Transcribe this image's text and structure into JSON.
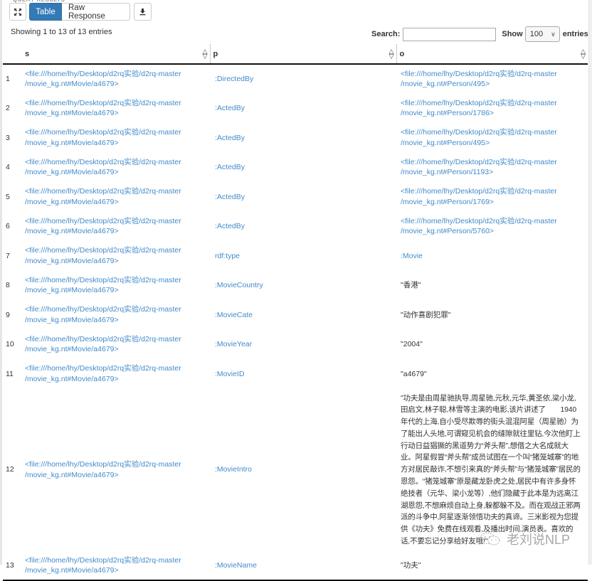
{
  "section_title": "Query Results",
  "toolbar": {
    "expand_icon": "expand-icon",
    "table_label": "Table",
    "raw_label": "Raw Response",
    "download_icon": "download-icon"
  },
  "info": "Showing 1 to 13 of 13 entries",
  "search": {
    "label": "Search:",
    "value": "",
    "placeholder": ""
  },
  "length": {
    "show_label": "Show",
    "selected": "100",
    "entries_label": "entries"
  },
  "colors": {
    "accent": "#337ab7",
    "link": "#428bca"
  },
  "columns": [
    {
      "label": "s"
    },
    {
      "label": "p"
    },
    {
      "label": "o"
    }
  ],
  "rows": [
    {
      "idx": "1",
      "s": "<file:///home/lhy/Desktop/d2rq实验/d2rq-master /movie_kg.nt#Movie/a4679>",
      "p": ":DirectedBy",
      "o": "<file:///home/lhy/Desktop/d2rq实验/d2rq-master /movie_kg.nt#Person/495>",
      "o_type": "uri"
    },
    {
      "idx": "2",
      "s": "<file:///home/lhy/Desktop/d2rq实验/d2rq-master /movie_kg.nt#Movie/a4679>",
      "p": ":ActedBy",
      "o": "<file:///home/lhy/Desktop/d2rq实验/d2rq-master /movie_kg.nt#Person/1786>",
      "o_type": "uri"
    },
    {
      "idx": "3",
      "s": "<file:///home/lhy/Desktop/d2rq实验/d2rq-master /movie_kg.nt#Movie/a4679>",
      "p": ":ActedBy",
      "o": "<file:///home/lhy/Desktop/d2rq实验/d2rq-master /movie_kg.nt#Person/495>",
      "o_type": "uri"
    },
    {
      "idx": "4",
      "s": "<file:///home/lhy/Desktop/d2rq实验/d2rq-master /movie_kg.nt#Movie/a4679>",
      "p": ":ActedBy",
      "o": "<file:///home/lhy/Desktop/d2rq实验/d2rq-master /movie_kg.nt#Person/1193>",
      "o_type": "uri"
    },
    {
      "idx": "5",
      "s": "<file:///home/lhy/Desktop/d2rq实验/d2rq-master /movie_kg.nt#Movie/a4679>",
      "p": ":ActedBy",
      "o": "<file:///home/lhy/Desktop/d2rq实验/d2rq-master /movie_kg.nt#Person/1769>",
      "o_type": "uri"
    },
    {
      "idx": "6",
      "s": "<file:///home/lhy/Desktop/d2rq实验/d2rq-master /movie_kg.nt#Movie/a4679>",
      "p": ":ActedBy",
      "o": "<file:///home/lhy/Desktop/d2rq实验/d2rq-master /movie_kg.nt#Person/5760>",
      "o_type": "uri"
    },
    {
      "idx": "7",
      "s": "<file:///home/lhy/Desktop/d2rq实验/d2rq-master /movie_kg.nt#Movie/a4679>",
      "p": "rdf:type",
      "o": ":Movie",
      "o_type": "uri"
    },
    {
      "idx": "8",
      "s": "<file:///home/lhy/Desktop/d2rq实验/d2rq-master /movie_kg.nt#Movie/a4679>",
      "p": ":MovieCountry",
      "o": "\"香港\"",
      "o_type": "literal"
    },
    {
      "idx": "9",
      "s": "<file:///home/lhy/Desktop/d2rq实验/d2rq-master /movie_kg.nt#Movie/a4679>",
      "p": ":MovieCate",
      "o": "\"动作喜剧犯罪\"",
      "o_type": "literal"
    },
    {
      "idx": "10",
      "s": "<file:///home/lhy/Desktop/d2rq实验/d2rq-master /movie_kg.nt#Movie/a4679>",
      "p": ":MovieYear",
      "o": "\"2004\"",
      "o_type": "literal"
    },
    {
      "idx": "11",
      "s": "<file:///home/lhy/Desktop/d2rq实验/d2rq-master /movie_kg.nt#Movie/a4679>",
      "p": ":MovieID",
      "o": "\"a4679\"",
      "o_type": "literal"
    },
    {
      "idx": "12",
      "s": "<file:///home/lhy/Desktop/d2rq实验/d2rq-master /movie_kg.nt#Movie/a4679>",
      "p": ":MovieIntro",
      "o": "\"功夫是由周星驰执导,周星驰,元秋,元华,黄圣依,梁小龙,田启文,林子聪,林雪等主演的电影,该片讲述了　　1940年代的上海,自小受尽欺辱的街头混混阿星（周星驰）为了能出人头地,可谓窥见机会的缝隙就往里钻,今次他盯上行动日益猖獗的黑道势力“斧头帮”,想借之大名成就大业。阿星假冒“斧头帮”成员试图在一个叫“猪笼城寨”的地方对居民敲诈,不想引来真的“斧头帮”与“猪笼城寨”居民的恩怨。“猪笼城寨”原是藏龙卧虎之处,居民中有许多身怀绝技者（元华、梁小龙等）,他们隐藏于此本是为远离江湖恩怨,不想麻烦自动上身,躲都躲不及。而在观战正邪两派的斗争中,阿星逐渐领悟功夫的真谛。三米影视为您提供《功夫》免费在线观看,及播出时间,演员表。喜欢的话,不要忘记分享给好友哦!\"",
      "o_type": "literal"
    },
    {
      "idx": "13",
      "s": "<file:///home/lhy/Desktop/d2rq实验/d2rq-master /movie_kg.nt#Movie/a4679>",
      "p": ":MovieName",
      "o": "\"功夫\"",
      "o_type": "literal"
    }
  ],
  "watermark": "老刘说NLP"
}
